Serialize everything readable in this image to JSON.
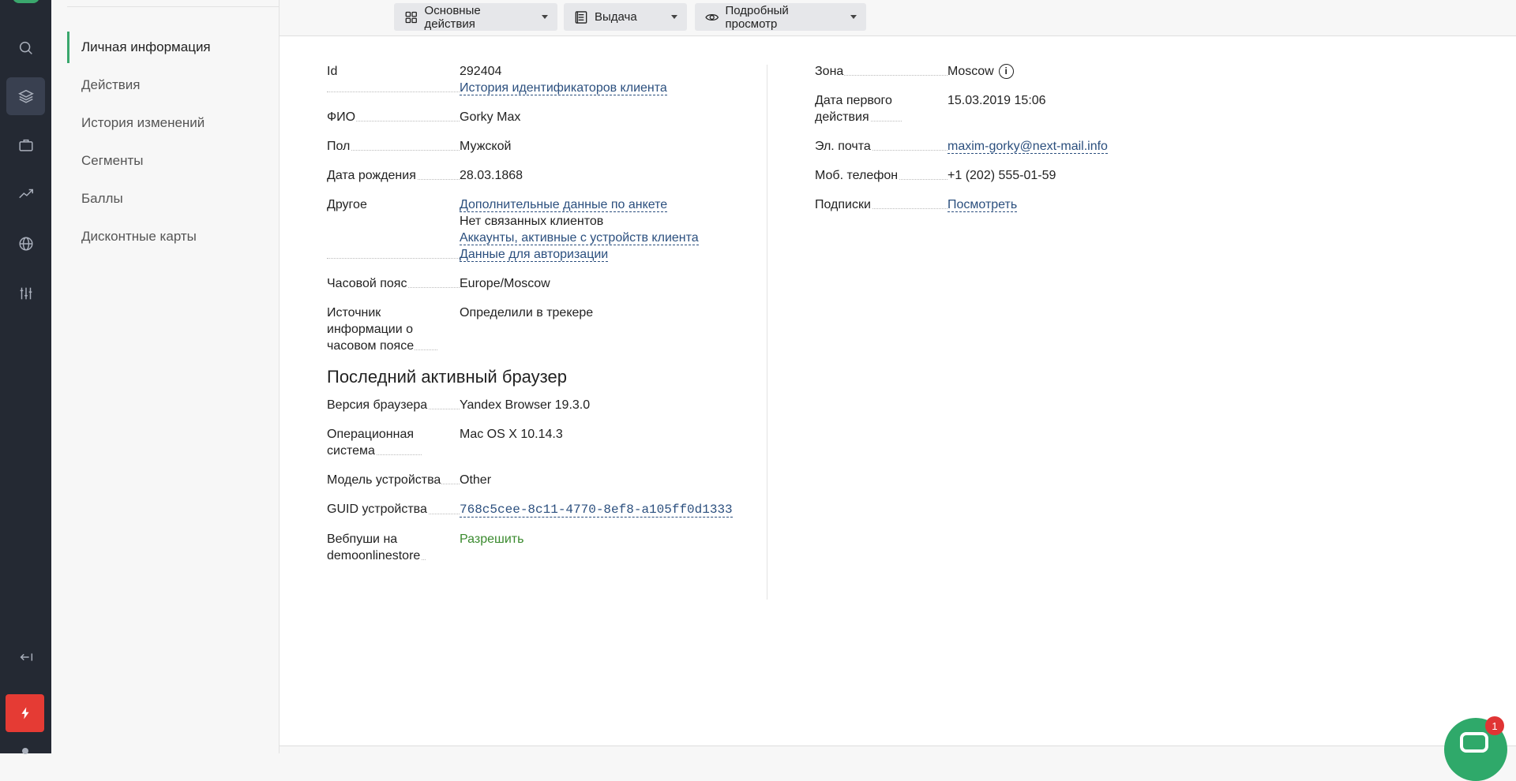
{
  "toolbar": {
    "main_actions": "Основные действия",
    "output": "Выдача",
    "detailed_view": "Подробный просмотр"
  },
  "subnav": {
    "items": [
      {
        "label": "Личная информация"
      },
      {
        "label": "Действия"
      },
      {
        "label": "История изменений"
      },
      {
        "label": "Сегменты"
      },
      {
        "label": "Баллы"
      },
      {
        "label": "Дисконтные карты"
      }
    ]
  },
  "left": {
    "id_label": "Id",
    "id_value": "292404",
    "id_history_link": "История идентификаторов клиента",
    "name_label": "ФИО",
    "name_value": "Gorky Max",
    "sex_label": "Пол",
    "sex_value": "Мужской",
    "birth_label": "Дата рождения",
    "birth_value": "28.03.1868",
    "other_label": "Другое",
    "other_link1": "Дополнительные данные по анкете",
    "other_text": "Нет связанных клиентов",
    "other_link2": "Аккаунты, активные с устройств клиента",
    "other_link3": "Данные для авторизации",
    "tz_label": "Часовой пояс",
    "tz_value": "Europe/Moscow",
    "tzsrc_label": "Источник информации о часовом поясе",
    "tzsrc_value": "Определили в трекере",
    "browser_heading": "Последний активный браузер",
    "bver_label": "Версия браузера",
    "bver_value": "Yandex Browser 19.3.0",
    "os_label": "Операционная система",
    "os_value": "Mac OS X 10.14.3",
    "model_label": "Модель устройства",
    "model_value": "Other",
    "guid_label": "GUID устройства",
    "guid_value": "768c5cee-8c11-4770-8ef8-a105ff0d1333",
    "push_label": "Вебпуши на demoonlinestore",
    "push_value": "Разрешить"
  },
  "right": {
    "zone_label": "Зона",
    "zone_value": "Moscow",
    "first_label": "Дата первого действия",
    "first_value": "15.03.2019 15:06",
    "email_label": "Эл. почта",
    "email_value": "maxim-gorky@next-mail.info",
    "phone_label": "Моб. телефон",
    "phone_value": "+1 (202) 555-01-59",
    "subs_label": "Подписки",
    "subs_value": "Посмотреть"
  },
  "chat": {
    "badge": "1"
  },
  "colors": {
    "accent": "#3aa76d",
    "link": "#2b4f7e",
    "rail": "#242933",
    "danger": "#e53b34"
  }
}
